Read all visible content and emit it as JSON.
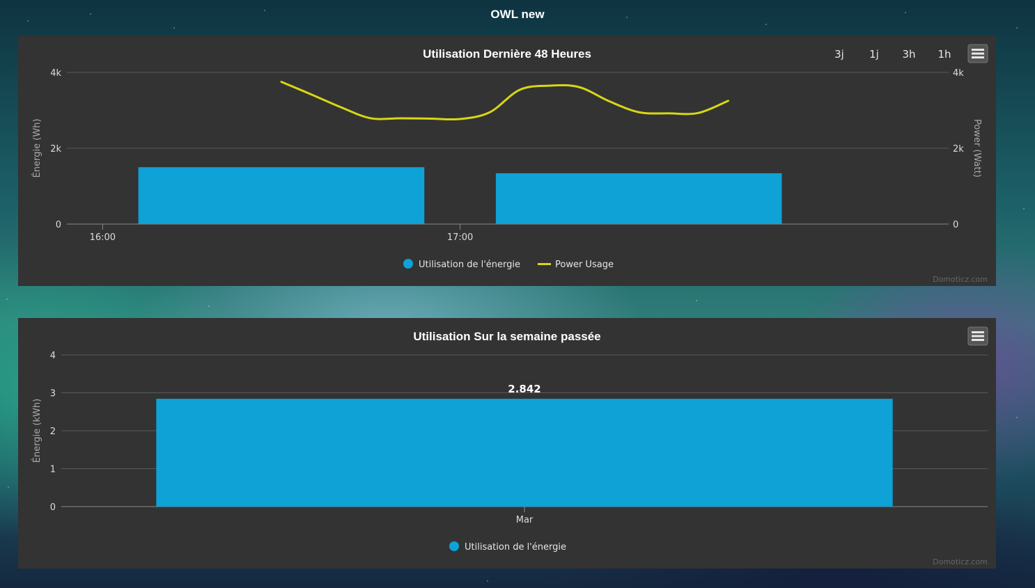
{
  "page": {
    "title": "OWL new"
  },
  "colors": {
    "bar": "#0ea2d6",
    "line": "#d7d714",
    "panel": "#333333",
    "grid": "#666666"
  },
  "charts": {
    "day": {
      "title": "Utilisation Dernière 48 Heures",
      "range_buttons": [
        "3j",
        "1j",
        "3h",
        "1h"
      ],
      "menu_icon": "hamburger-menu-icon",
      "y_left_title": "Énergie (Wh)",
      "y_right_title": "Power (Watt)",
      "y_ticks": [
        "0",
        "2k",
        "4k"
      ],
      "x_ticks": [
        "16:00",
        "17:00"
      ],
      "legend": [
        "Utilisation de l'énergie",
        "Power Usage"
      ],
      "credit": "Domoticz.com"
    },
    "week": {
      "title": "Utilisation Sur la semaine passée",
      "menu_icon": "hamburger-menu-icon",
      "y_title": "Énergie (kWh)",
      "y_ticks": [
        "0",
        "1",
        "2",
        "3",
        "4"
      ],
      "x_ticks": [
        "Mar"
      ],
      "data_label": "2.842",
      "legend": [
        "Utilisation de l'énergie"
      ],
      "credit": "Domoticz.com"
    }
  },
  "chart_data": [
    {
      "type": "bar",
      "title": "Utilisation Dernière 48 Heures",
      "ylabel": "Énergie (Wh)",
      "y2label": "Power (Watt)",
      "ylim": [
        0,
        4000
      ],
      "y2lim": [
        0,
        4000
      ],
      "x_unit": "hours",
      "grid": true,
      "legend_position": "bottom",
      "series": [
        {
          "name": "Utilisation de l'énergie",
          "type": "bar",
          "x": [
            "16:30",
            "17:30"
          ],
          "values": [
            1500,
            1340
          ]
        },
        {
          "name": "Power Usage",
          "type": "line",
          "x": [
            "16:30",
            "16:35",
            "16:40",
            "16:45",
            "16:50",
            "16:55",
            "17:00",
            "17:05",
            "17:10",
            "17:15",
            "17:20",
            "17:25",
            "17:30",
            "17:35",
            "17:40",
            "17:45"
          ],
          "values": [
            3750,
            3420,
            3080,
            2790,
            2790,
            2780,
            2770,
            2950,
            3540,
            3650,
            3610,
            3240,
            2950,
            2920,
            2930,
            3250
          ]
        }
      ]
    },
    {
      "type": "bar",
      "title": "Utilisation Sur la semaine passée",
      "categories": [
        "Mar"
      ],
      "ylabel": "Énergie (kWh)",
      "ylim": [
        0,
        4
      ],
      "grid": true,
      "legend_position": "bottom",
      "series": [
        {
          "name": "Utilisation de l'énergie",
          "values": [
            2.842
          ]
        }
      ]
    }
  ]
}
